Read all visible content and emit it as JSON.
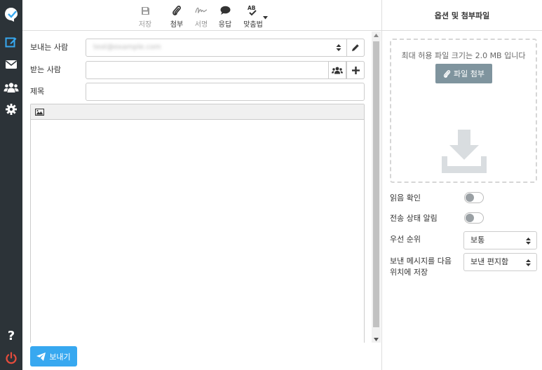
{
  "toolbar": {
    "save": "저장",
    "attach": "첨부",
    "signature": "서명",
    "responses": "응답",
    "spellcheck": "맞춤법"
  },
  "compose": {
    "from_label": "보내는 사람",
    "from_value": "test@example.com",
    "to_label": "받는 사람",
    "to_value": "",
    "subject_label": "제목",
    "subject_value": ""
  },
  "send": {
    "label": "보내기"
  },
  "panel": {
    "title": "옵션 및 첨부파일",
    "max_size_text": "최대 허용 파일 크기는 2.0 MB 입니다",
    "attach_button": "파일 첨부",
    "read_receipt": "읽음 확인",
    "delivery_status": "전송 상태 알림",
    "priority_label": "우선 순위",
    "priority_value": "보통",
    "save_in_label_1": "보낸 메시지를 다음",
    "save_in_label_2": "위치에 저장",
    "save_in_value": "보낸 편지함"
  },
  "colors": {
    "rail": "#2c3338",
    "accent": "#37a8f0",
    "attach_btn": "#7f949e",
    "logout": "#e74c3c"
  },
  "toggles": {
    "read_receipt": false,
    "delivery_status": false
  }
}
